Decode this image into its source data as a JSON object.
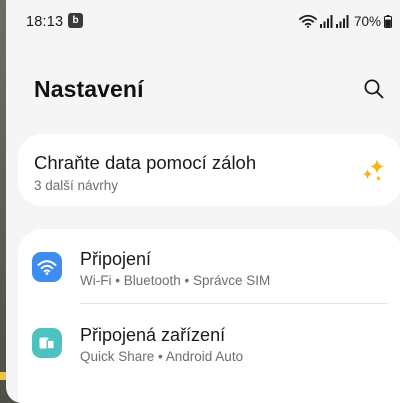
{
  "status_bar": {
    "time": "18:13",
    "app_icon_letter": "b",
    "battery_percent": "70%"
  },
  "header": {
    "title": "Nastavení"
  },
  "backup_suggestion": {
    "title": "Chraňte data pomocí záloh",
    "subtitle": "3 další návrhy"
  },
  "settings": [
    {
      "title": "Připojení",
      "subtitle": "Wi-Fi  •  Bluetooth  •  Správce SIM",
      "icon": "wifi-icon",
      "icon_color": "#3d8cf0"
    },
    {
      "title": "Připojená zařízení",
      "subtitle": "Quick Share  •  Android Auto",
      "icon": "connected-devices-icon",
      "icon_color": "#4cc3c0"
    }
  ],
  "colors": {
    "background": "#f5f5f6",
    "card": "#ffffff",
    "sparkle": "#f2b51c"
  }
}
